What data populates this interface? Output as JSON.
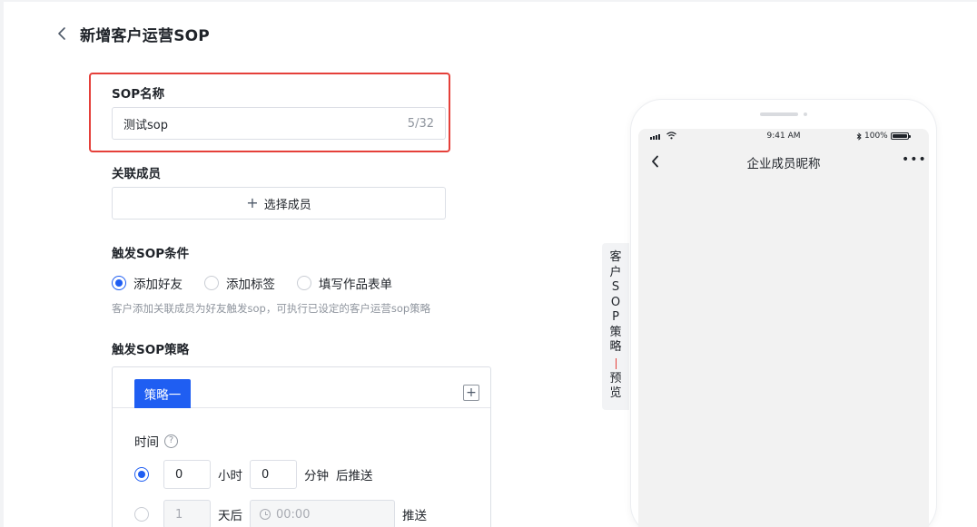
{
  "header": {
    "title": "新增客户运营SOP"
  },
  "form": {
    "name_label": "SOP名称",
    "name_value": "测试sop",
    "name_counter": "5/32",
    "member_label": "关联成员",
    "member_button": "选择成员",
    "trigger_label": "触发SOP条件",
    "trigger_options": [
      {
        "label": "添加好友",
        "checked": true
      },
      {
        "label": "添加标签",
        "checked": false
      },
      {
        "label": "填写作品表单",
        "checked": false
      }
    ],
    "trigger_hint": "客户添加关联成员为好友触发sop，可执行已设定的客户运营sop策略",
    "strategy_label": "触发SOP策略",
    "strategy": {
      "tab": "策略一",
      "time_label": "时间",
      "option_a": {
        "hours": "0",
        "hours_unit": "小时",
        "minutes": "0",
        "minutes_unit": "分钟",
        "suffix": "后推送"
      },
      "option_b": {
        "days": "1",
        "days_unit": "天后",
        "time_placeholder": "00:00",
        "suffix": "推送"
      }
    }
  },
  "side_tab": {
    "chars_top": [
      "客",
      "户",
      "S",
      "O",
      "P",
      "策",
      "略"
    ],
    "chars_bottom": [
      "预",
      "览"
    ]
  },
  "phone": {
    "time": "9:41 AM",
    "battery": "100%",
    "battery_level": 1.0,
    "title": "企业成员昵称",
    "more": "•••"
  },
  "colors": {
    "primary": "#1f5ef2",
    "highlight": "#e5403a",
    "preview_bg": "#f2f2f2"
  }
}
